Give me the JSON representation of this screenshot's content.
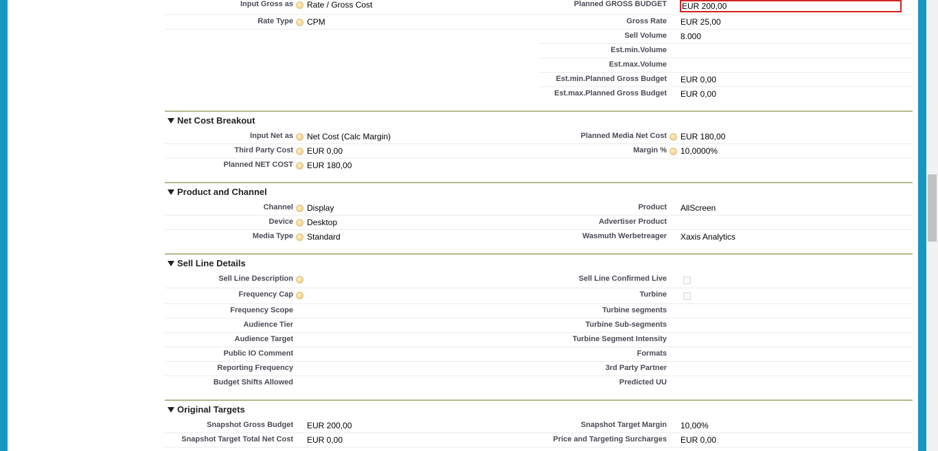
{
  "top": {
    "input_gross_as_label": "Input Gross as",
    "input_gross_as_value": "Rate / Gross Cost",
    "rate_type_label": "Rate Type",
    "rate_type_value": "CPM",
    "planned_gross_budget_label": "Planned GROSS BUDGET",
    "planned_gross_budget_value": "EUR 200,00",
    "gross_rate_label": "Gross Rate",
    "gross_rate_value": "EUR 25,00",
    "sell_volume_label": "Sell Volume",
    "sell_volume_value": "8.000",
    "est_min_volume_label": "Est.min.Volume",
    "est_max_volume_label": "Est.max.Volume",
    "est_min_budget_label": "Est.min.Planned Gross Budget",
    "est_min_budget_value": "EUR 0,00",
    "est_max_budget_label": "Est.max.Planned Gross Budget",
    "est_max_budget_value": "EUR 0,00"
  },
  "net_cost": {
    "title": "Net Cost Breakout",
    "input_net_as_label": "Input Net as",
    "input_net_as_value": "Net Cost (Calc Margin)",
    "third_party_cost_label": "Third Party Cost",
    "third_party_cost_value": "EUR 0,00",
    "planned_net_cost_label": "Planned NET COST",
    "planned_net_cost_value": "EUR 180,00",
    "planned_media_net_cost_label": "Planned Media Net Cost",
    "planned_media_net_cost_value": "EUR 180,00",
    "margin_label": "Margin %",
    "margin_value": "10,0000%"
  },
  "product_channel": {
    "title": "Product and Channel",
    "channel_label": "Channel",
    "channel_value": "Display",
    "device_label": "Device",
    "device_value": "Desktop",
    "media_type_label": "Media Type",
    "media_type_value": "Standard",
    "product_label": "Product",
    "product_value": "AllScreen",
    "advertiser_product_label": "Advertiser Product",
    "wasmuth_label": "Wasmuth Werbetreager",
    "wasmuth_value": "Xaxis Analytics"
  },
  "sell_line": {
    "title": "Sell Line Details",
    "description_label": "Sell Line Description",
    "frequency_cap_label": "Frequency Cap",
    "frequency_scope_label": "Frequency Scope",
    "audience_tier_label": "Audience Tier",
    "audience_target_label": "Audience Target",
    "public_io_comment_label": "Public IO Comment",
    "reporting_frequency_label": "Reporting Frequency",
    "budget_shifts_label": "Budget Shifts Allowed",
    "confirmed_live_label": "Sell Line Confirmed Live",
    "turbine_label": "Turbine",
    "turbine_segments_label": "Turbine segments",
    "turbine_sub_segments_label": "Turbine Sub-segments",
    "turbine_intensity_label": "Turbine Segment Intensity",
    "formats_label": "Formats",
    "third_party_partner_label": "3rd Party Partner",
    "predicted_uu_label": "Predicted UU"
  },
  "original_targets": {
    "title": "Original Targets",
    "snapshot_gross_budget_label": "Snapshot Gross Budget",
    "snapshot_gross_budget_value": "EUR 200,00",
    "snapshot_total_net_cost_label": "Snapshot Target Total Net Cost",
    "snapshot_total_net_cost_value": "EUR 0,00",
    "snapshot_target_margin_label": "Snapshot Target Margin",
    "snapshot_target_margin_value": "10,00%",
    "surcharges_label": "Price and Targeting Surcharges",
    "surcharges_value": "EUR 0,00"
  },
  "icons": {
    "help": "help-icon",
    "collapse": "triangle-down-icon",
    "checkbox": "checkbox-icon"
  },
  "colors": {
    "frame": "#1797c0",
    "section_rule": "#b6b78a",
    "edit_border": "#d42020",
    "label_text": "#4a4a56"
  }
}
